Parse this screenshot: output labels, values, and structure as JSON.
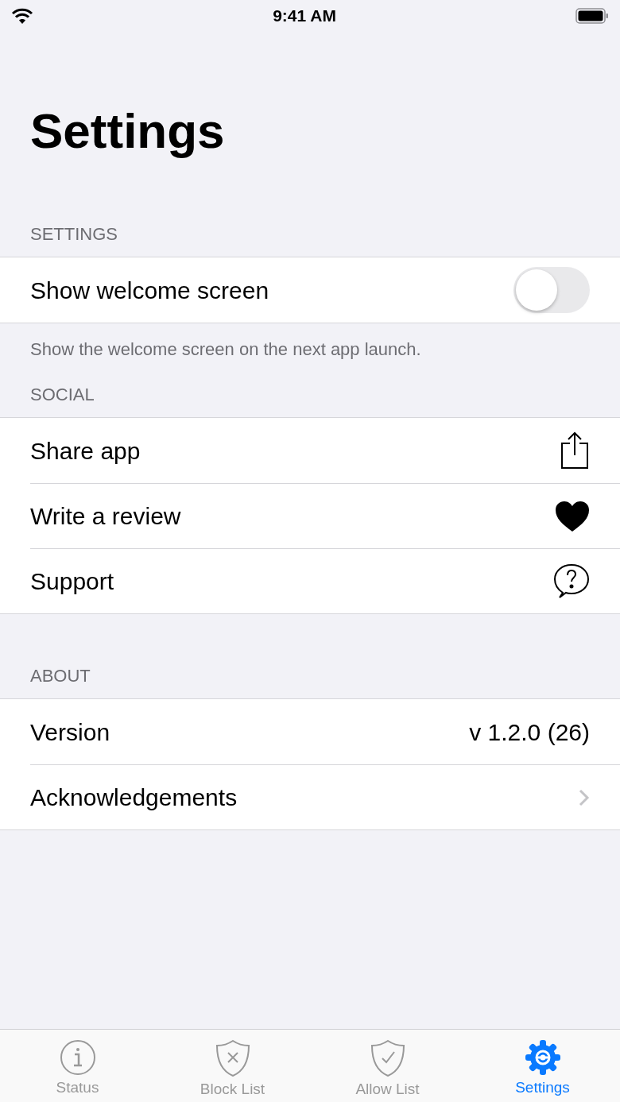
{
  "status_bar": {
    "time": "9:41 AM"
  },
  "title": "Settings",
  "sections": [
    {
      "header": "SETTINGS",
      "footer": "Show the welcome screen on the next app launch.",
      "rows": [
        {
          "kind": "toggle",
          "label": "Show welcome screen",
          "on": false
        }
      ]
    },
    {
      "header": "SOCIAL",
      "rows": [
        {
          "kind": "share",
          "label": "Share app"
        },
        {
          "kind": "heart",
          "label": "Write a review"
        },
        {
          "kind": "help",
          "label": "Support"
        }
      ]
    },
    {
      "header": "ABOUT",
      "rows": [
        {
          "kind": "value",
          "label": "Version",
          "value": "v 1.2.0 (26)"
        },
        {
          "kind": "disclosure",
          "label": "Acknowledgements"
        }
      ]
    }
  ],
  "tabs": [
    {
      "kind": "info",
      "label": "Status",
      "selected": false
    },
    {
      "kind": "block",
      "label": "Block List",
      "selected": false
    },
    {
      "kind": "allow",
      "label": "Allow List",
      "selected": false
    },
    {
      "kind": "gear",
      "label": "Settings",
      "selected": true
    }
  ]
}
